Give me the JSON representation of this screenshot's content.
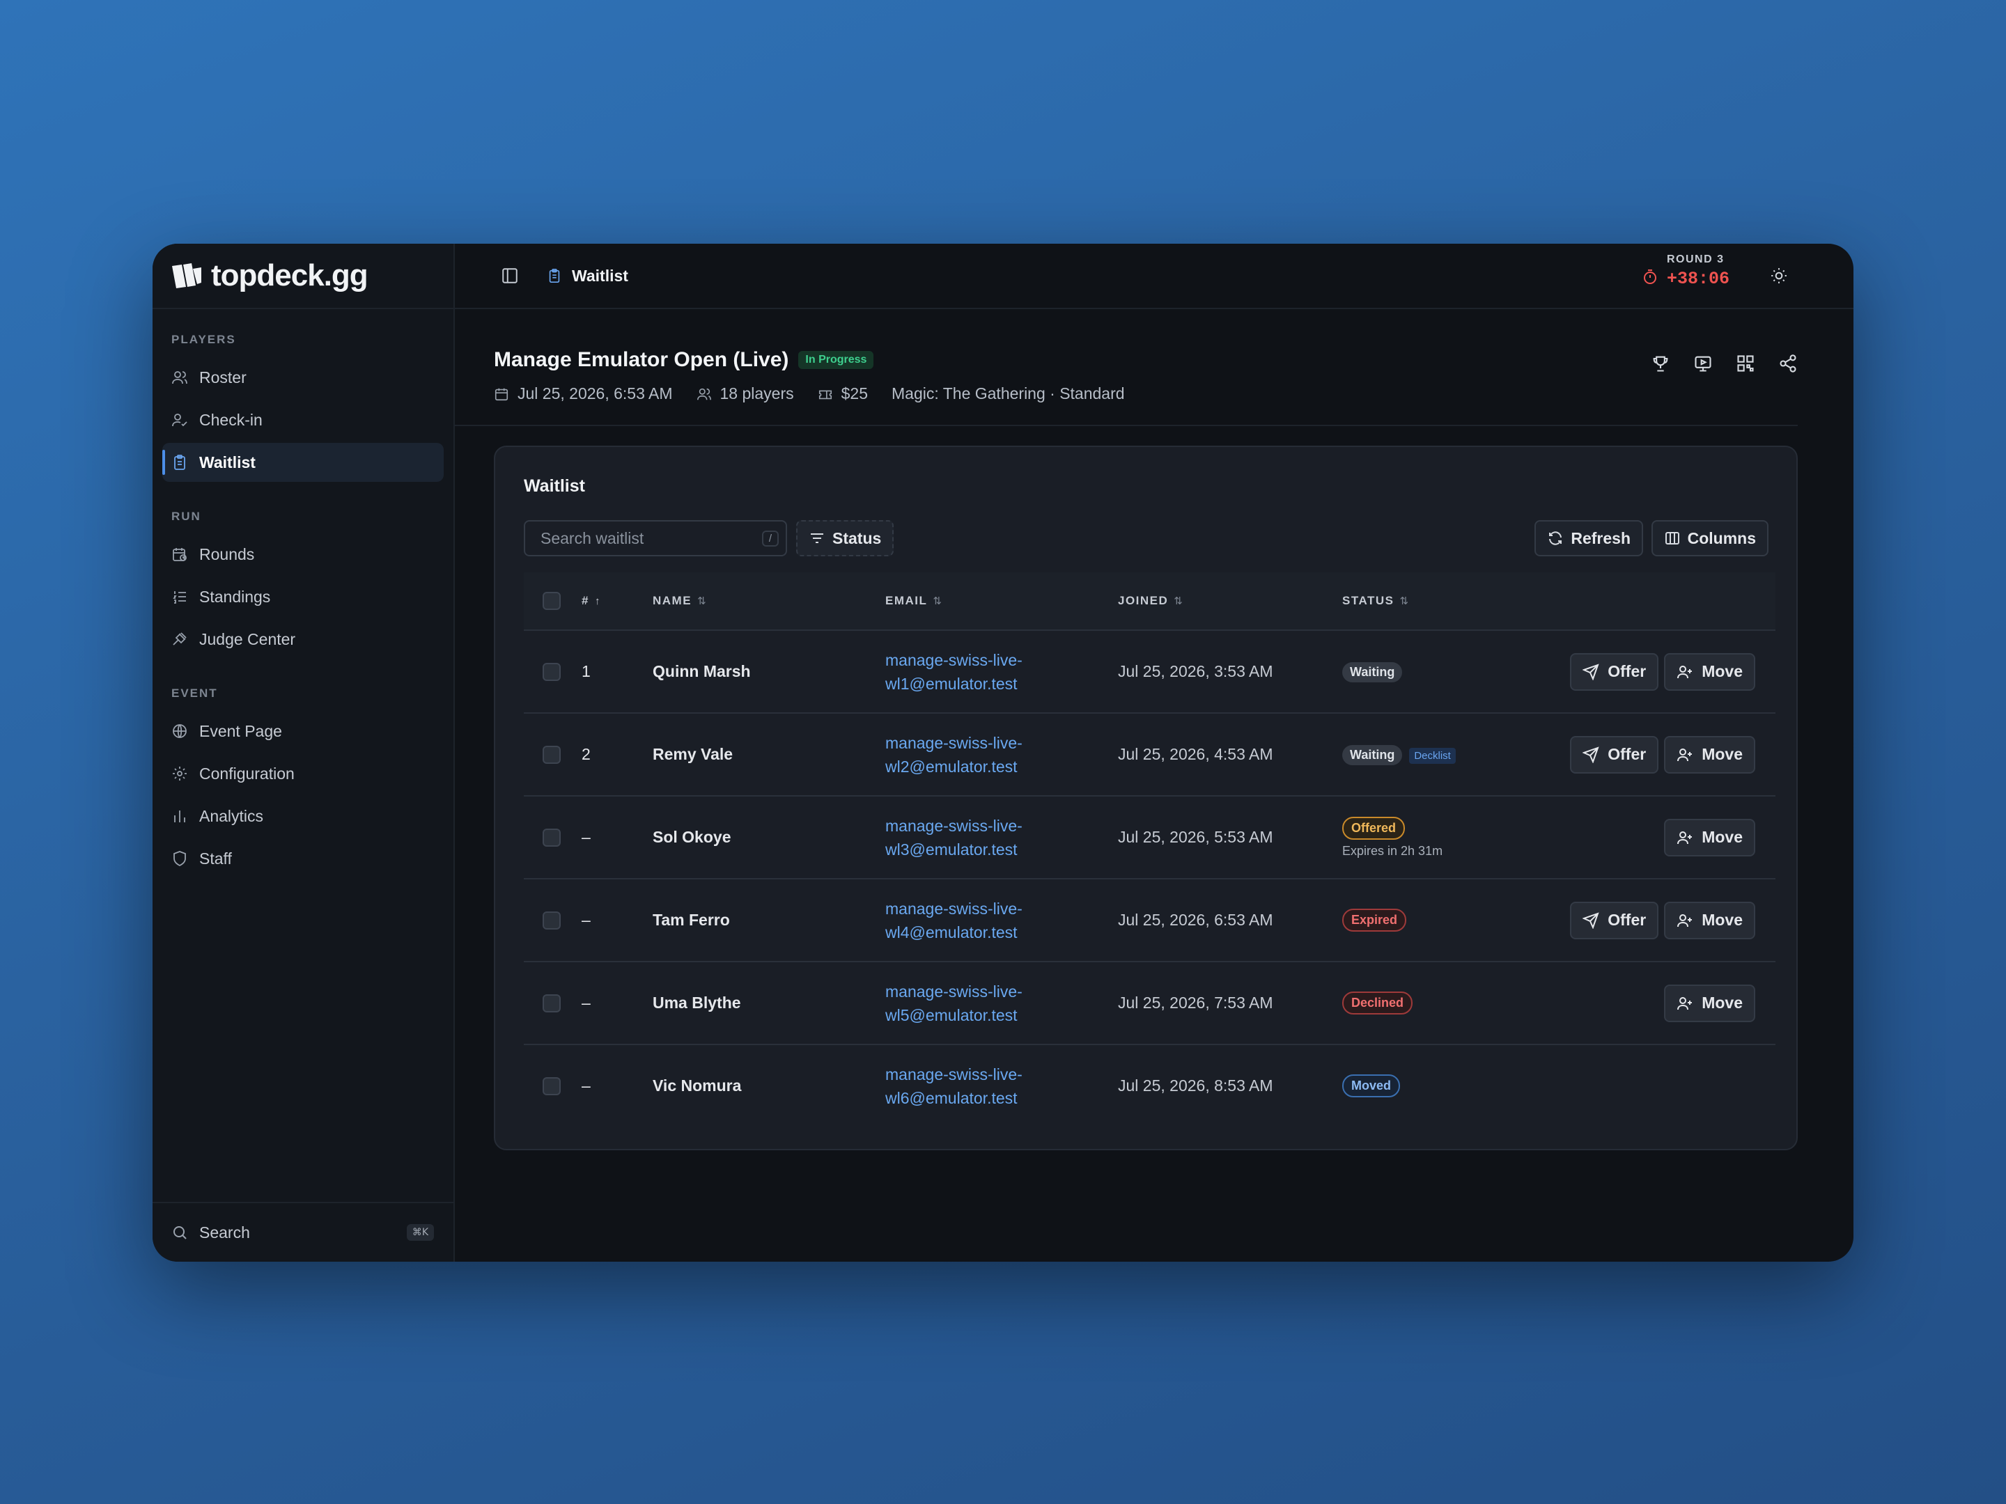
{
  "brand": {
    "name": "topdeck.gg"
  },
  "sidebar": {
    "sections": [
      {
        "label": "PLAYERS",
        "items": [
          {
            "label": "Roster",
            "icon": "users-icon"
          },
          {
            "label": "Check-in",
            "icon": "user-check-icon"
          },
          {
            "label": "Waitlist",
            "icon": "clipboard-icon",
            "active": true
          }
        ]
      },
      {
        "label": "RUN",
        "items": [
          {
            "label": "Rounds",
            "icon": "calendar-clock-icon"
          },
          {
            "label": "Standings",
            "icon": "list-ordered-icon"
          },
          {
            "label": "Judge Center",
            "icon": "gavel-icon"
          }
        ]
      },
      {
        "label": "EVENT",
        "items": [
          {
            "label": "Event Page",
            "icon": "globe-icon"
          },
          {
            "label": "Configuration",
            "icon": "gear-icon"
          },
          {
            "label": "Analytics",
            "icon": "bar-chart-icon"
          },
          {
            "label": "Staff",
            "icon": "shield-icon"
          }
        ]
      }
    ],
    "search": {
      "label": "Search",
      "shortcut": "⌘K"
    }
  },
  "topbar": {
    "breadcrumb": "Waitlist",
    "round_label": "ROUND 3",
    "round_timer": "+38:06"
  },
  "event": {
    "title": "Manage Emulator Open (Live)",
    "status": "In Progress",
    "date": "Jul 25, 2026, 6:53 AM",
    "players": "18",
    "players_label": "players",
    "fee": "$25",
    "format": "Magic: The Gathering · Standard"
  },
  "waitlist": {
    "title": "Waitlist",
    "search_placeholder": "Search waitlist",
    "search_shortcut": "/",
    "status_filter": "Status",
    "refresh": "Refresh",
    "columns": "Columns",
    "headers": {
      "num": "#",
      "name": "NAME",
      "email": "EMAIL",
      "joined": "JOINED",
      "status": "STATUS"
    },
    "rows": [
      {
        "num": "1",
        "name": "Quinn Marsh",
        "email1": "manage-swiss-live-",
        "email2": "wl1@emulator.test",
        "joined": "Jul 25, 2026, 3:53 AM",
        "status": "Waiting",
        "offer": "Offer",
        "move": "Move"
      },
      {
        "num": "2",
        "name": "Remy Vale",
        "email1": "manage-swiss-live-",
        "email2": "wl2@emulator.test",
        "joined": "Jul 25, 2026, 4:53 AM",
        "status": "Waiting",
        "tag": "Decklist",
        "offer": "Offer",
        "move": "Move"
      },
      {
        "num": "–",
        "name": "Sol Okoye",
        "email1": "manage-swiss-live-",
        "email2": "wl3@emulator.test",
        "joined": "Jul 25, 2026, 5:53 AM",
        "status": "Offered",
        "note": "Expires in 2h 31m",
        "move": "Move"
      },
      {
        "num": "–",
        "name": "Tam Ferro",
        "email1": "manage-swiss-live-",
        "email2": "wl4@emulator.test",
        "joined": "Jul 25, 2026, 6:53 AM",
        "status": "Expired",
        "offer": "Offer",
        "move": "Move"
      },
      {
        "num": "–",
        "name": "Uma Blythe",
        "email1": "manage-swiss-live-",
        "email2": "wl5@emulator.test",
        "joined": "Jul 25, 2026, 7:53 AM",
        "status": "Declined",
        "move": "Move"
      },
      {
        "num": "–",
        "name": "Vic Nomura",
        "email1": "manage-swiss-live-",
        "email2": "wl6@emulator.test",
        "joined": "Jul 25, 2026, 8:53 AM",
        "status": "Moved"
      }
    ]
  },
  "colors": {
    "accent": "#4c8ee8",
    "timer": "#ef5350",
    "success": "#3ecf8e"
  }
}
